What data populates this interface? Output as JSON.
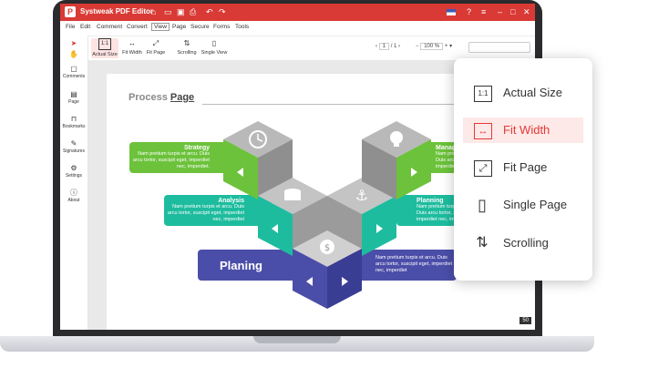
{
  "app": {
    "title": "Systweak PDF Editor",
    "logo_letter": "P"
  },
  "titlebar_icons": [
    "home-icon",
    "folder-icon",
    "save-icon",
    "print-icon",
    "undo-icon",
    "redo-icon"
  ],
  "menu": [
    "File",
    "Edit",
    "Comment",
    "Convert",
    "View",
    "Page",
    "Secure",
    "Forms",
    "Tools"
  ],
  "menu_active": "View",
  "toolbar": {
    "actual_size": "Actual Size",
    "fit_width": "Fit Width",
    "fit_page": "Fit Page",
    "scrolling": "Scrolling",
    "single_view": "Single View",
    "page_current": "1",
    "page_total": "/ 1",
    "zoom": "100 %"
  },
  "sidebar": {
    "comments": "Comments",
    "page": "Page",
    "bookmarks": "Bookmarks",
    "signatures": "Signatures",
    "settings": "Settings",
    "about": "About"
  },
  "document": {
    "title_light": "Process ",
    "title_bold": "Page",
    "strategy": {
      "title": "Strategy",
      "desc": "Nam pretium turpis et arcu. Duis arcu tortor, suscipit eget, imperdiet nec, imperdiet."
    },
    "analysis": {
      "title": "Analysis",
      "desc": "Nam pretium turpis et arcu. Duis arcu tortor, suscipit eget, imperdiet nec, imperdiet"
    },
    "planning": {
      "title": "Planning",
      "desc": "Nam pretium turpis et arcu. Duis arcu tortor, suscipit eget, imperdiet nec, imperdiet"
    },
    "management": {
      "title": "Manag",
      "desc": "Nam pretium tu Duis arcu tort imperdiet nec,"
    },
    "planing": {
      "title": "Planing",
      "desc": "Nam pretium turpis et arcu. Duis arcu tortor, suscipit eget, imperdiet nec, imperdiet"
    },
    "page_number": "50"
  },
  "dropdown": {
    "items": [
      {
        "icon": "1:1",
        "label": "Actual Size"
      },
      {
        "icon": "↔",
        "label": "Fit Width",
        "selected": true
      },
      {
        "icon": "⤢",
        "label": "Fit Page"
      },
      {
        "icon": "▯",
        "label": "Single Page"
      },
      {
        "icon": "⇅",
        "label": "Scrolling"
      }
    ]
  },
  "colors": {
    "accent": "#d93a35",
    "green": "#6cc23b",
    "teal": "#1ebc9e",
    "purple": "#4b4ea8",
    "selected_bg": "#fde9e8"
  }
}
